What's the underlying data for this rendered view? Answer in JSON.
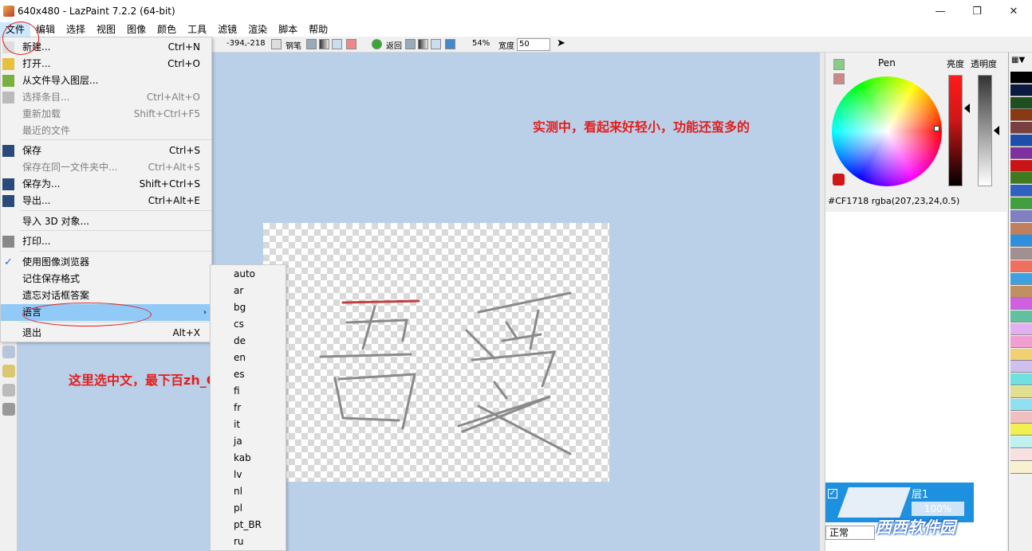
{
  "window": {
    "title": "640x480 - LazPaint 7.2.2 (64-bit)",
    "minimize": "—",
    "restore": "❐",
    "close": "✕"
  },
  "menubar": {
    "items": [
      "文件",
      "编辑",
      "选择",
      "视图",
      "图像",
      "颜色",
      "工具",
      "滤镜",
      "渲染",
      "脚本",
      "帮助"
    ]
  },
  "toolbar": {
    "coords": "-394,-218",
    "pen_label": "钢笔",
    "return_label": "返回",
    "zoom": "54%",
    "width_label": "宽度",
    "width_value": "50"
  },
  "file_menu": {
    "items": [
      {
        "label": "新建...",
        "shortcut": "Ctrl+N",
        "disabled": false
      },
      {
        "label": "打开...",
        "shortcut": "Ctrl+O",
        "disabled": false
      },
      {
        "label": "从文件导入图层...",
        "shortcut": "",
        "disabled": false
      },
      {
        "label": "选择条目...",
        "shortcut": "Ctrl+Alt+O",
        "disabled": true
      },
      {
        "label": "重新加载",
        "shortcut": "Shift+Ctrl+F5",
        "disabled": true
      },
      {
        "label": "最近的文件",
        "shortcut": "",
        "disabled": true
      },
      {
        "label": "保存",
        "shortcut": "Ctrl+S",
        "disabled": false
      },
      {
        "label": "保存在同一文件夹中...",
        "shortcut": "Ctrl+Alt+S",
        "disabled": true
      },
      {
        "label": "保存为...",
        "shortcut": "Shift+Ctrl+S",
        "disabled": false
      },
      {
        "label": "导出...",
        "shortcut": "Ctrl+Alt+E",
        "disabled": false
      },
      {
        "label": "导入 3D 对象...",
        "shortcut": "",
        "disabled": false
      },
      {
        "label": "打印...",
        "shortcut": "",
        "disabled": false
      },
      {
        "label": "使用图像浏览器",
        "shortcut": "",
        "disabled": false
      },
      {
        "label": "记住保存格式",
        "shortcut": "",
        "disabled": false
      },
      {
        "label": "遗忘对话框答案",
        "shortcut": "",
        "disabled": false
      },
      {
        "label": "语言",
        "shortcut": "",
        "disabled": false
      },
      {
        "label": "退出",
        "shortcut": "Alt+X",
        "disabled": false
      }
    ]
  },
  "language_menu": {
    "items": [
      "auto",
      "ar",
      "bg",
      "cs",
      "de",
      "en",
      "es",
      "fi",
      "fr",
      "it",
      "ja",
      "kab",
      "lv",
      "nl",
      "pl",
      "pt_BR",
      "ru"
    ]
  },
  "annotations": {
    "top_right": "实测中，看起来好轻小，功能还蛮多的",
    "language_hint": "这里选中文，最下百zh_CN"
  },
  "color_panel": {
    "tool_name": "Pen",
    "brightness_label": "亮度",
    "alpha_label": "透明度",
    "current_color": "#cf1718",
    "color_text": "#CF1718  rgba(207,23,24,0.5)"
  },
  "layer_panel": {
    "layer_name": "层1",
    "opacity": "100%",
    "blend_mode": "正常"
  },
  "palette": {
    "colors": [
      "#000000",
      "#0b1a3e",
      "#1f4e1f",
      "#8a3a12",
      "#7a4040",
      "#1f4eaa",
      "#7f2f9f",
      "#c81414",
      "#3f7a1f",
      "#3060c0",
      "#40a040",
      "#8080c0",
      "#c08060",
      "#3090e0",
      "#a09090",
      "#f07060",
      "#40a0e0",
      "#c09060",
      "#d060e0",
      "#60c0a0",
      "#e0b0f0",
      "#f0a0d0",
      "#f0d070",
      "#d0c0f0",
      "#70e0e0",
      "#e0e090",
      "#90e0f0",
      "#f0c0c0",
      "#f0f050",
      "#c0f0f0",
      "#f8e0e0",
      "#f8f0d0"
    ]
  },
  "watermark": "西西软件园"
}
